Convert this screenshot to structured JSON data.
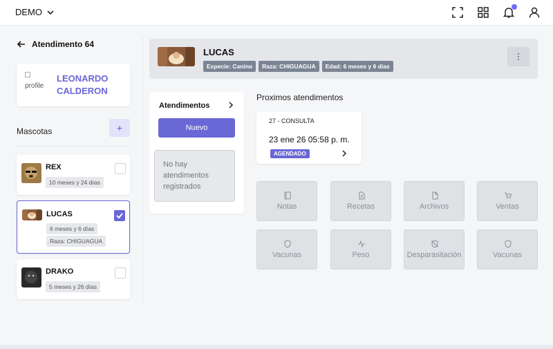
{
  "topbar": {
    "brand": "DEMO",
    "icons": [
      "fullscreen-icon",
      "apps-grid-icon",
      "bell-icon",
      "user-icon"
    ]
  },
  "sidebar": {
    "back_title": "Atendimento 64",
    "owner": {
      "img_alt": "profile",
      "name": "LEONARDO CALDERON"
    },
    "pets_title": "Mascotas",
    "add_label": "+",
    "pets": [
      {
        "name": "REX",
        "chips": [
          "10 meses y 24 días"
        ],
        "checked": false
      },
      {
        "name": "LUCAS",
        "chips": [
          "6 meses y 6 días",
          "Raza: CHIGUAGUA"
        ],
        "checked": true
      },
      {
        "name": "DRAKO",
        "chips": [
          "5 meses y 26 días"
        ],
        "checked": false
      }
    ]
  },
  "header": {
    "pet_name": "LUCAS",
    "chips": [
      "Especie: Canino",
      "Raza: CHIGUAGUA",
      "Edad: 6 meses y 6 días"
    ]
  },
  "atendimentos": {
    "title": "Atendimentos",
    "new_button": "Nuevo",
    "empty_text": "No hay atendimentos registrados"
  },
  "proximos": {
    "title": "Proximos atendimentos",
    "card": {
      "type": "27 - CONSULTA",
      "date": "23 ene 26 05:58 p. m.",
      "status": "AGENDADO"
    }
  },
  "tiles": [
    {
      "label": "Notas",
      "icon": "notebook-icon"
    },
    {
      "label": "Recetas",
      "icon": "document-icon"
    },
    {
      "label": "Archivos",
      "icon": "file-icon"
    },
    {
      "label": "Ventas",
      "icon": "cart-icon"
    },
    {
      "label": "Vacunas",
      "icon": "shield-icon"
    },
    {
      "label": "Peso",
      "icon": "activity-icon"
    },
    {
      "label": "Desparasitación",
      "icon": "shield-off-icon"
    },
    {
      "label": "Vacunas",
      "icon": "shield-icon"
    }
  ],
  "colors": {
    "accent": "#6a67d6",
    "chip_dark": "#7b8494",
    "tile_bg": "#dfe1e5",
    "notification": "#6f6bff"
  }
}
